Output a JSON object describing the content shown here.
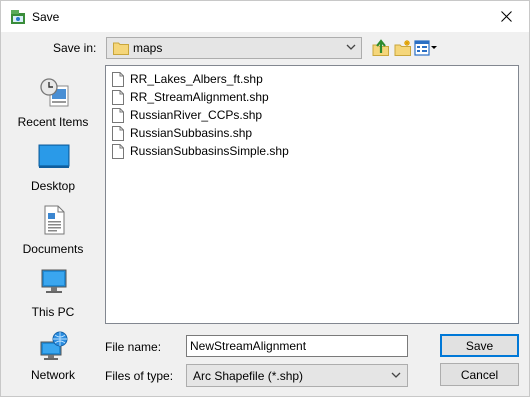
{
  "window": {
    "title": "Save"
  },
  "save_in": {
    "label": "Save in:",
    "value": "maps"
  },
  "places": [
    {
      "label": "Recent Items"
    },
    {
      "label": "Desktop"
    },
    {
      "label": "Documents"
    },
    {
      "label": "This PC"
    },
    {
      "label": "Network"
    }
  ],
  "files": [
    {
      "name": "RR_Lakes_Albers_ft.shp"
    },
    {
      "name": "RR_StreamAlignment.shp"
    },
    {
      "name": "RussianRiver_CCPs.shp"
    },
    {
      "name": "RussianSubbasins.shp"
    },
    {
      "name": "RussianSubbasinsSimple.shp"
    }
  ],
  "file_name": {
    "label": "File name:",
    "value": "NewStreamAlignment"
  },
  "file_type": {
    "label": "Files of type:",
    "value": "Arc Shapefile (*.shp)"
  },
  "buttons": {
    "save": "Save",
    "cancel": "Cancel"
  },
  "colors": {
    "accent": "#0078d7",
    "folder": "#e8c04a",
    "desktop_blue": "#1e8ad6"
  }
}
